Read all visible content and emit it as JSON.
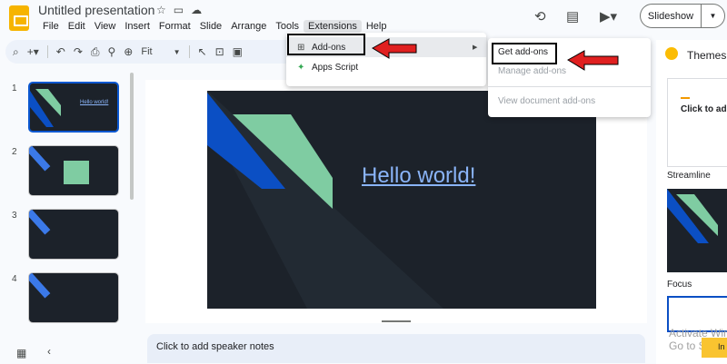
{
  "header": {
    "title": "Untitled presentation",
    "menu": [
      "File",
      "Edit",
      "View",
      "Insert",
      "Format",
      "Slide",
      "Arrange",
      "Tools",
      "Extensions",
      "Help"
    ],
    "active_menu": "Extensions",
    "slideshow_label": "Slideshow"
  },
  "toolbar": {
    "zoom_label": "Fit",
    "icons": [
      "search-icon",
      "add-icon",
      "undo-icon",
      "redo-icon",
      "print-icon",
      "paint-format-icon",
      "zoom-icon",
      "select-icon",
      "textbox-icon",
      "image-icon"
    ]
  },
  "filmstrip": {
    "slides": [
      {
        "number": "1",
        "selected": true,
        "text": "Hello world!"
      },
      {
        "number": "2",
        "selected": false
      },
      {
        "number": "3",
        "selected": false
      },
      {
        "number": "4",
        "selected": false
      }
    ]
  },
  "slide": {
    "text": "Hello world!"
  },
  "notes": {
    "placeholder": "Click to add speaker notes"
  },
  "themes": {
    "title": "Themes",
    "items": [
      {
        "name": "Streamline",
        "preview_text": "Click to add"
      },
      {
        "name": "Focus"
      }
    ],
    "activate_text": "Activate Windows\nGo to Settings",
    "install_label": "In"
  },
  "extensions_menu": {
    "items": [
      {
        "label": "Add-ons",
        "icon": "addon-icon",
        "has_submenu": true
      },
      {
        "label": "Apps Script",
        "icon": "apps-script-icon",
        "has_submenu": false
      }
    ]
  },
  "addons_submenu": {
    "items": [
      {
        "label": "Get add-ons",
        "disabled": false
      },
      {
        "label": "Manage add-ons",
        "disabled": true
      },
      {
        "label": "View document add-ons",
        "disabled": true
      }
    ]
  },
  "colors": {
    "slide_bg": "#1c222a",
    "accent_blue": "#0b4fc4",
    "accent_green": "#7fcca2",
    "link_text": "#8ab4f8",
    "annotation_arrow": "#e02020"
  }
}
